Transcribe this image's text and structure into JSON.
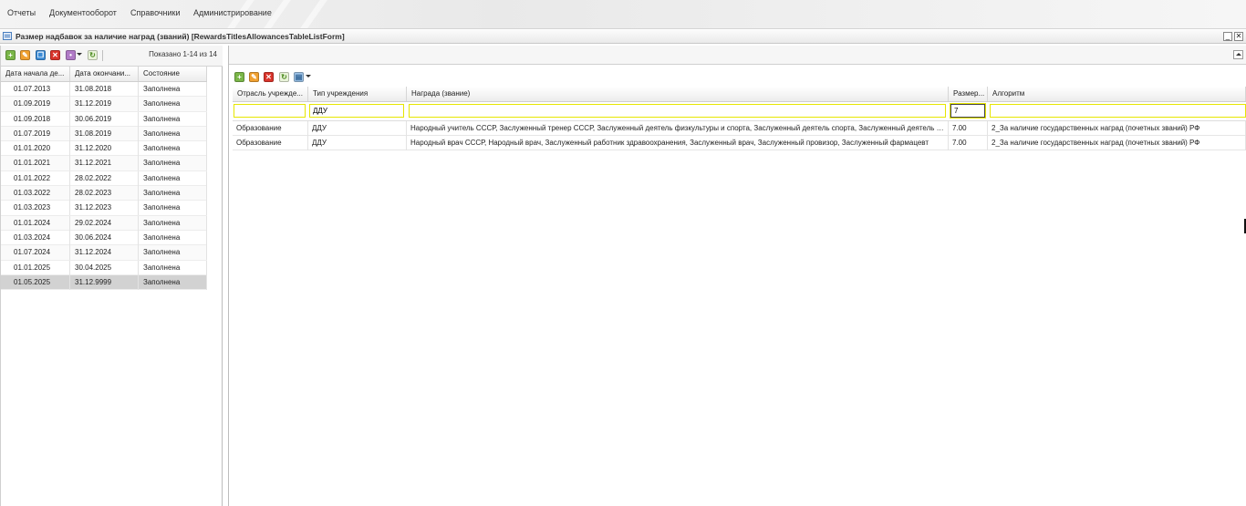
{
  "menu": [
    "Отчеты",
    "Документооборот",
    "Справочники",
    "Администрирование"
  ],
  "window": {
    "title": "Размер надбавок за наличие наград (званий) [RewardsTitlesAllowancesTableListForm]",
    "minimize": "_",
    "close": "✕"
  },
  "left": {
    "paging": "Показано 1-14 из 14",
    "columns": [
      "Дата начала де...",
      "Дата окончани...",
      "Состояние"
    ],
    "rows": [
      [
        "01.07.2013",
        "31.08.2018",
        "Заполнена"
      ],
      [
        "01.09.2019",
        "31.12.2019",
        "Заполнена"
      ],
      [
        "01.09.2018",
        "30.06.2019",
        "Заполнена"
      ],
      [
        "01.07.2019",
        "31.08.2019",
        "Заполнена"
      ],
      [
        "01.01.2020",
        "31.12.2020",
        "Заполнена"
      ],
      [
        "01.01.2021",
        "31.12.2021",
        "Заполнена"
      ],
      [
        "01.01.2022",
        "28.02.2022",
        "Заполнена"
      ],
      [
        "01.03.2022",
        "28.02.2023",
        "Заполнена"
      ],
      [
        "01.03.2023",
        "31.12.2023",
        "Заполнена"
      ],
      [
        "01.01.2024",
        "29.02.2024",
        "Заполнена"
      ],
      [
        "01.03.2024",
        "30.06.2024",
        "Заполнена"
      ],
      [
        "01.07.2024",
        "31.12.2024",
        "Заполнена"
      ],
      [
        "01.01.2025",
        "30.04.2025",
        "Заполнена"
      ],
      [
        "01.05.2025",
        "31.12.9999",
        "Заполнена"
      ]
    ],
    "selected_row": 13
  },
  "right": {
    "columns": [
      "Отрасль учрежде...",
      "Тип учреждения",
      "Награда (звание)",
      "Размер...",
      "Алгоритм"
    ],
    "filters": [
      "",
      "ДДУ",
      "",
      "7",
      ""
    ],
    "rows": [
      [
        "Образование",
        "ДДУ",
        "Народный учитель СССР, Заслуженный тренер СССР, Заслуженный деятель физкультуры и спорта, Заслуженный деятель спорта, Заслуженный деятель науки",
        "7.00",
        "2_За наличие государственных наград (почетных званий) РФ"
      ],
      [
        "Образование",
        "ДДУ",
        "Народный врач СССР, Народный врач, Заслуженный работник здравоохранения, Заслуженный врач, Заслуженный провизор, Заслуженный фармацевт",
        "7.00",
        "2_За наличие государственных наград (почетных званий) РФ"
      ]
    ]
  },
  "icons": {
    "add": "add-icon",
    "edit": "edit-icon",
    "copy": "copy-icon",
    "delete": "delete-icon",
    "more": "more-icon",
    "refresh": "refresh-icon",
    "print": "print-icon"
  }
}
